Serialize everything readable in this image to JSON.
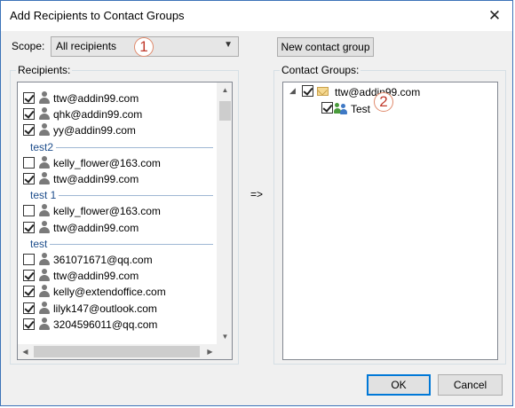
{
  "window": {
    "title": "Add Recipients to Contact Groups",
    "close_glyph": "✕"
  },
  "scope": {
    "label": "Scope:",
    "value": "All recipients"
  },
  "badges": {
    "one": "1",
    "two": "2"
  },
  "buttons": {
    "new_group": "New contact group",
    "ok": "OK",
    "cancel": "Cancel"
  },
  "recipients": {
    "caption": "Recipients:",
    "rows": [
      {
        "type": "item",
        "label": "ttw@addin99.com",
        "checked": true
      },
      {
        "type": "item",
        "label": "qhk@addin99.com",
        "checked": true
      },
      {
        "type": "item",
        "label": "yy@addin99.com",
        "checked": true
      },
      {
        "type": "group",
        "label": "test2"
      },
      {
        "type": "item",
        "label": "kelly_flower@163.com",
        "checked": false
      },
      {
        "type": "item",
        "label": "ttw@addin99.com",
        "checked": true
      },
      {
        "type": "group",
        "label": "test 1"
      },
      {
        "type": "item",
        "label": "kelly_flower@163.com",
        "checked": false
      },
      {
        "type": "item",
        "label": "ttw@addin99.com",
        "checked": true
      },
      {
        "type": "group",
        "label": "test"
      },
      {
        "type": "item",
        "label": "361071671@qq.com",
        "checked": false
      },
      {
        "type": "item",
        "label": "ttw@addin99.com",
        "checked": true
      },
      {
        "type": "item",
        "label": "kelly@extendoffice.com",
        "checked": true
      },
      {
        "type": "item",
        "label": "lilyk147@outlook.com",
        "checked": true
      },
      {
        "type": "item",
        "label": "3204596011@qq.com",
        "checked": true
      }
    ]
  },
  "transfer_arrow": "=>",
  "contact_groups": {
    "caption": "Contact Groups:",
    "account": {
      "label": "ttw@addin99.com",
      "checked": true,
      "icon": "envelope-icon"
    },
    "group": {
      "label": "Test",
      "checked": true,
      "icon": "contact-group-icon"
    }
  },
  "colors": {
    "accent": "#0078d7",
    "group_header": "#1e4e8c",
    "badge_text": "#c0392b"
  }
}
